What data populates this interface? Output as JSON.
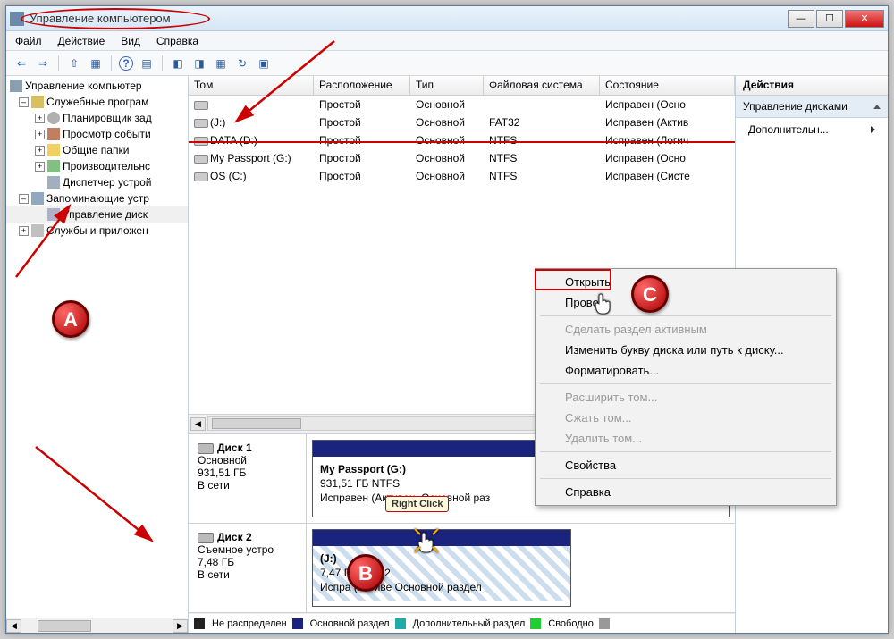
{
  "window": {
    "title": "Управление компьютером"
  },
  "menubar": {
    "file": "Файл",
    "action": "Действие",
    "view": "Вид",
    "help": "Справка"
  },
  "tree": {
    "root": "Управление компьютер",
    "tools": "Служебные програм",
    "scheduler": "Планировщик зад",
    "events": "Просмотр событи",
    "folders": "Общие папки",
    "perf": "Производительнс",
    "devmgr": "Диспетчер устрой",
    "storage": "Запоминающие устр",
    "diskmgmt": "Управление диск",
    "services": "Службы и приложен"
  },
  "columns": {
    "volume": "Том",
    "layout": "Расположение",
    "type": "Тип",
    "fs": "Файловая система",
    "state": "Состояние"
  },
  "volumes": [
    {
      "name": "",
      "layout": "Простой",
      "type": "Основной",
      "fs": "",
      "state": "Исправен (Осно"
    },
    {
      "name": "(J:)",
      "layout": "Простой",
      "type": "Основной",
      "fs": "FAT32",
      "state": "Исправен (Актив"
    },
    {
      "name": "DATA (D:)",
      "layout": "Простой",
      "type": "Основной",
      "fs": "NTFS",
      "state": "Исправен (Логич"
    },
    {
      "name": "My Passport (G:)",
      "layout": "Простой",
      "type": "Основной",
      "fs": "NTFS",
      "state": "Исправен (Осно"
    },
    {
      "name": "OS (C:)",
      "layout": "Простой",
      "type": "Основной",
      "fs": "NTFS",
      "state": "Исправен (Систе"
    }
  ],
  "disks": {
    "d1": {
      "name": "Диск 1",
      "type": "Основной",
      "size": "931,51 ГБ",
      "status": "В сети",
      "part_title": "My Passport  (G:)",
      "part_sub": "931,51 ГБ NTFS",
      "part_state": "Исправен (Активен, Основной раз"
    },
    "d2": {
      "name": "Диск 2",
      "type": "Съемное устро",
      "size": "7,48 ГБ",
      "status": "В сети",
      "part_title": "(J:)",
      "part_sub": "7,47 ГБ FAT32",
      "part_state": "Испра         (Активе    Основной раздел"
    }
  },
  "legend": {
    "unalloc": "Не распределен",
    "primary": "Основной раздел",
    "extended": "Дополнительный раздел",
    "free": "Свободно"
  },
  "actions": {
    "header": "Действия",
    "section": "Управление дисками",
    "more": "Дополнительн..."
  },
  "ctx": {
    "open": "Открыть",
    "explorer": "Провод",
    "active": "Сделать раздел активным",
    "letter": "Изменить букву диска или путь к диску...",
    "format": "Форматировать...",
    "extend": "Расширить том...",
    "shrink": "Сжать том...",
    "delete": "Удалить том...",
    "props": "Свойства",
    "help": "Справка"
  },
  "annot": {
    "a": "A",
    "b": "B",
    "c": "C",
    "rc": "Right Click"
  }
}
